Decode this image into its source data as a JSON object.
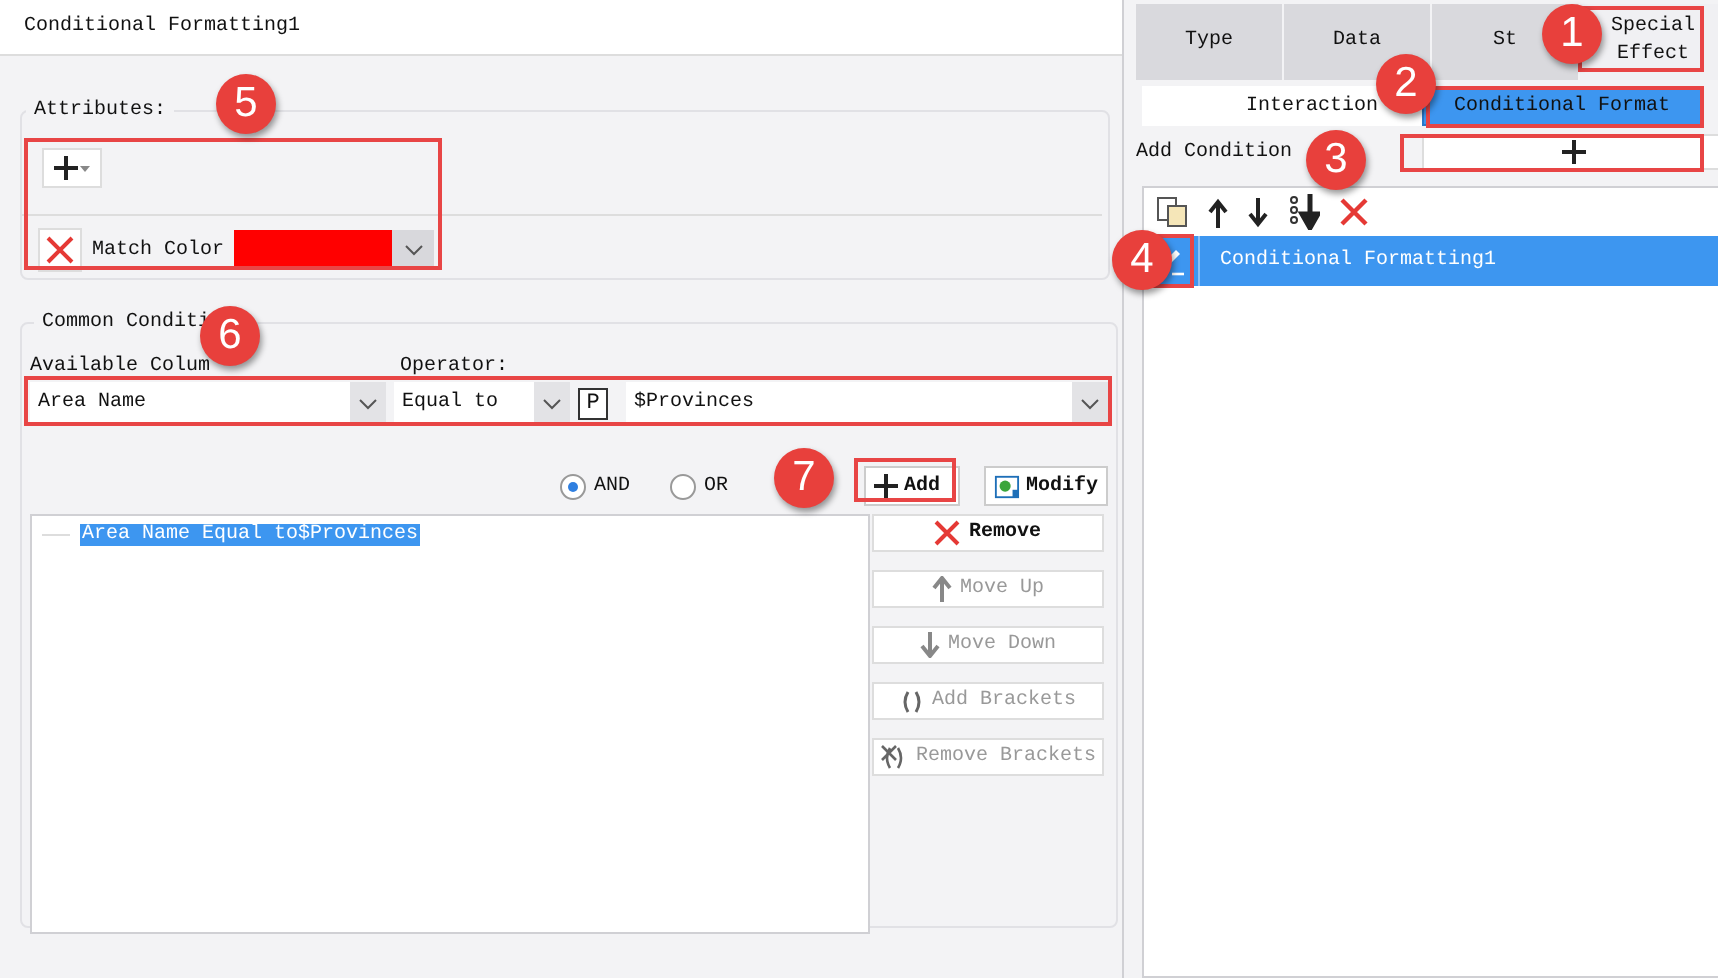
{
  "title": "Conditional Formatting1",
  "attributes": {
    "legend": "Attributes:",
    "items": [
      {
        "label": "Match Color",
        "color": "#ff0000"
      }
    ]
  },
  "conditions": {
    "legend": "Common Conditi",
    "column_label": "Available Colum",
    "operator_label": "Operator:",
    "column_value": "Area Name",
    "operator_value": "Equal to",
    "param_button": "P",
    "value": "$Provinces",
    "logic": [
      {
        "label": "AND",
        "selected": true
      },
      {
        "label": "OR",
        "selected": false
      }
    ],
    "add": "Add",
    "modify": "Modify",
    "rules": [
      {
        "text": "Area Name Equal to$Provinces",
        "selected": true
      }
    ],
    "actions": [
      {
        "label": "Remove",
        "kind": "remove",
        "disabled": false
      },
      {
        "label": "Move Up",
        "kind": "up",
        "disabled": true
      },
      {
        "label": "Move Down",
        "kind": "down",
        "disabled": true
      },
      {
        "label": "Add Brackets",
        "kind": "brackets",
        "disabled": true
      },
      {
        "label": "Remove Brackets",
        "kind": "unbrackets",
        "disabled": true
      }
    ]
  },
  "tabs": [
    {
      "label": "Type",
      "selected": false
    },
    {
      "label": "Data",
      "selected": false
    },
    {
      "label": "St",
      "selected": false
    },
    {
      "label": "Special Effect",
      "selected": true
    }
  ],
  "subtabs": [
    {
      "label": "Interaction",
      "selected": false
    },
    {
      "label": "Conditional Format",
      "selected": true
    }
  ],
  "add_condition": "Add Condition",
  "formats": [
    {
      "name": "Conditional Formatting1",
      "selected": true
    }
  ],
  "callouts": [
    "1",
    "2",
    "3",
    "4",
    "5",
    "6",
    "7"
  ]
}
